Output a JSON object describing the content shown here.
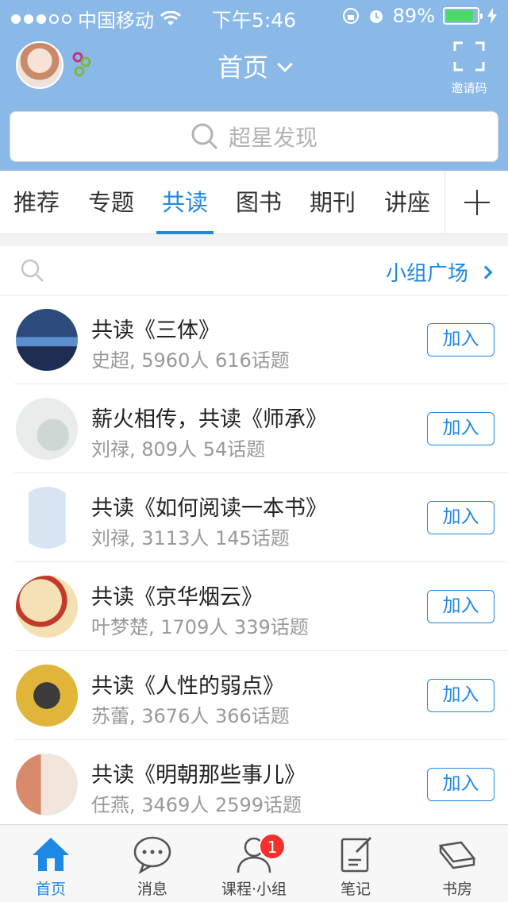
{
  "status": {
    "carrier": "中国移动",
    "time": "下午5:46",
    "battery": "89%",
    "battery_level": 0.89
  },
  "header": {
    "title": "首页",
    "invite_label": "邀请码"
  },
  "search": {
    "placeholder": "超星发现"
  },
  "tabs": [
    {
      "label": "推荐"
    },
    {
      "label": "专题"
    },
    {
      "label": "共读",
      "active": true
    },
    {
      "label": "图书"
    },
    {
      "label": "期刊"
    },
    {
      "label": "讲座"
    }
  ],
  "filter": {
    "plaza_label": "小组广场"
  },
  "groups": [
    {
      "title": "共读《三体》",
      "meta": "史超, 5960人 616话题",
      "join": "加入"
    },
    {
      "title": "薪火相传，共读《师承》",
      "meta": "刘禄, 809人 54话题",
      "join": "加入"
    },
    {
      "title": "共读《如何阅读一本书》",
      "meta": "刘禄, 3113人 145话题",
      "join": "加入"
    },
    {
      "title": "共读《京华烟云》",
      "meta": "叶梦楚, 1709人 339话题",
      "join": "加入"
    },
    {
      "title": "共读《人性的弱点》",
      "meta": "苏蕾, 3676人 366话题",
      "join": "加入"
    },
    {
      "title": "共读《明朝那些事儿》",
      "meta": "任燕, 3469人 2599话题",
      "join": "加入"
    }
  ],
  "nav": [
    {
      "label": "首页",
      "icon": "home-icon",
      "active": true
    },
    {
      "label": "消息",
      "icon": "chat-icon"
    },
    {
      "label": "课程·小组",
      "icon": "person-icon",
      "badge": "1"
    },
    {
      "label": "笔记",
      "icon": "note-icon"
    },
    {
      "label": "书房",
      "icon": "books-icon"
    }
  ],
  "colors": {
    "header_bg": "#8ab9e8",
    "accent": "#1e88e5",
    "badge": "#f4312d"
  }
}
